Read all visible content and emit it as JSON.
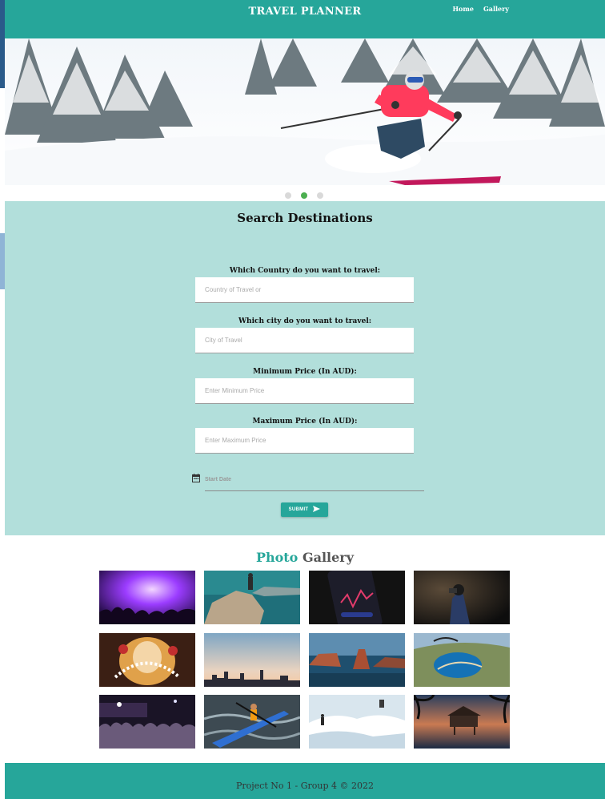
{
  "navbar": {
    "brand": "TRAVEL PLANNER",
    "links": [
      {
        "label": "Home"
      },
      {
        "label": "Gallery"
      }
    ],
    "color": "#26a69a"
  },
  "carousel": {
    "slide_count": 3,
    "active_index": 1,
    "indicator_active_color": "#4caf50",
    "image": "skier-in-snowy-forest"
  },
  "search": {
    "title": "Search Destinations",
    "background": "#b2dfdb",
    "fields": [
      {
        "label": "Which Country do you want to travel:",
        "placeholder": "Country of Travel or",
        "value": ""
      },
      {
        "label": "Which city do you want to travel:",
        "placeholder": "City of Travel",
        "value": ""
      },
      {
        "label": "Minimum Price (In AUD):",
        "placeholder": "Enter Minimum Price",
        "value": ""
      },
      {
        "label": "Maximum Price (In AUD):",
        "placeholder": "Enter Maximum Price",
        "value": ""
      }
    ],
    "start_date": {
      "placeholder": "Start Date",
      "icon": "calendar-icon"
    },
    "submit": {
      "label": "SUBMIT",
      "icon": "send-icon"
    }
  },
  "gallery": {
    "title_accent": "Photo",
    "title_rest": "Gallery",
    "photos": [
      "concert-crowd-purple-lights",
      "hiker-on-cliff-turquoise-water",
      "phone-stock-chart",
      "photographer-at-night",
      "festival-idol-decorations",
      "city-skyline-at-dusk",
      "sea-rocks-coastline",
      "paraglider-over-bay",
      "crowd-at-concert-stage",
      "kayaker-on-river",
      "snowboarder-in-snow",
      "pier-house-at-sunset"
    ]
  },
  "footer": {
    "text": "Project No 1 - Group 4 © 2022"
  }
}
